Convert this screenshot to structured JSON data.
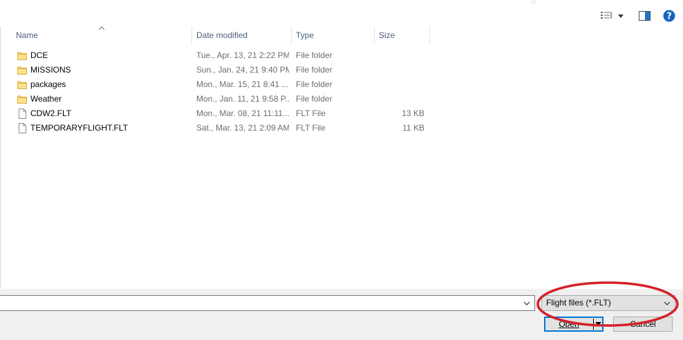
{
  "toolbar": {
    "icons": [
      "view-options-icon",
      "chevron-down-icon",
      "preview-pane-icon",
      "help-icon"
    ]
  },
  "file_list": {
    "columns": {
      "name": "Name",
      "date_modified": "Date modified",
      "type": "Type",
      "size": "Size"
    },
    "rows": [
      {
        "icon": "folder-icon",
        "name": "DCE",
        "date": "Tue., Apr. 13, 21 2:22 PM",
        "type": "File folder",
        "size": ""
      },
      {
        "icon": "folder-icon",
        "name": "MISSIONS",
        "date": "Sun., Jan. 24, 21 9:40 PM",
        "type": "File folder",
        "size": ""
      },
      {
        "icon": "folder-icon",
        "name": "packages",
        "date": "Mon., Mar. 15, 21 8:41 ...",
        "type": "File folder",
        "size": ""
      },
      {
        "icon": "folder-icon",
        "name": "Weather",
        "date": "Mon., Jan. 11, 21 9:58 P...",
        "type": "File folder",
        "size": ""
      },
      {
        "icon": "file-icon",
        "name": "CDW2.FLT",
        "date": "Mon., Mar. 08, 21 11:11...",
        "type": "FLT File",
        "size": "13 KB"
      },
      {
        "icon": "file-icon",
        "name": "TEMPORARYFLIGHT.FLT",
        "date": "Sat., Mar. 13, 21 2:09 AM",
        "type": "FLT File",
        "size": "11 KB"
      }
    ]
  },
  "bottom": {
    "file_name_value": "",
    "file_type_selected": "Flight files (*.FLT)",
    "open_label": "Open",
    "cancel_label": "Cancel"
  },
  "colors": {
    "accent": "#0078d7",
    "help_blue": "#1565c0",
    "folder_yellow": "#f8d775",
    "annotation_red": "#d6202a"
  }
}
